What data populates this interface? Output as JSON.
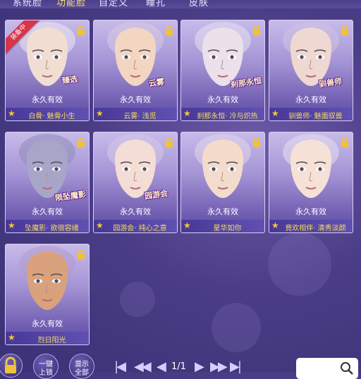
{
  "tabs": [
    {
      "label": "系统脸",
      "active": false
    },
    {
      "label": "功能脸",
      "active": true
    },
    {
      "label": "自定义",
      "active": false
    },
    {
      "label": "瞳孔",
      "active": false
    },
    {
      "label": "皮肤",
      "active": false
    }
  ],
  "cards": [
    {
      "status": "永久有效",
      "name": "白骨· 魅骨小生",
      "badge": "臻选",
      "ribbon": "装备中",
      "skin": "#f1ded3",
      "hair": "#efe8ee"
    },
    {
      "status": "永久有效",
      "name": "云雾· 浅觅",
      "badge": "云雾",
      "ribbon": "",
      "skin": "#f2d6c2",
      "hair": "#d8c9e4"
    },
    {
      "status": "永久有效",
      "name": "刹那永恒· 冷与炽热",
      "badge": "刹那永恒",
      "ribbon": "",
      "skin": "#ece0ea",
      "hair": "#e6e0f0"
    },
    {
      "status": "永久有效",
      "name": "驯兽师· 魅面驭兽",
      "badge": "驯兽师",
      "ribbon": "",
      "skin": "#f0d8d2",
      "hair": "#cfc2e0"
    },
    {
      "status": "永久有效",
      "name": "坠魔影· 欲宿容绪",
      "badge": "陨坠魔影",
      "ribbon": "",
      "skin": "#a8a6c8",
      "hair": "#8f8ab8"
    },
    {
      "status": "永久有效",
      "name": "园游会· 纯心之意",
      "badge": "园游会",
      "ribbon": "",
      "skin": "#f3ddd5",
      "hair": "#d6c8e6"
    },
    {
      "status": "永久有效",
      "name": "星华如你",
      "badge": "",
      "ribbon": "",
      "skin": "#f3dccc",
      "hair": "#e2d6ea"
    },
    {
      "status": "永久有效",
      "name": "竟欢相伴· 清秀淡颜",
      "badge": "",
      "ribbon": "",
      "skin": "#f6e1d6",
      "hair": "#e8dfee"
    },
    {
      "status": "永久有效",
      "name": "烈日阳光",
      "badge": "",
      "ribbon": "",
      "skin": "#d9a27c",
      "hair": "#b49ac6"
    }
  ],
  "controls": {
    "btn1": {
      "line1": "一键",
      "line2": "上锁"
    },
    "btn2": {
      "line1": "显示",
      "line2": "全部"
    },
    "page": "1/1"
  },
  "colors": {
    "name_text": "#f7dd58",
    "star": "#f5c832",
    "lock": "#f0c23a",
    "ribbon": "#d8344b"
  }
}
